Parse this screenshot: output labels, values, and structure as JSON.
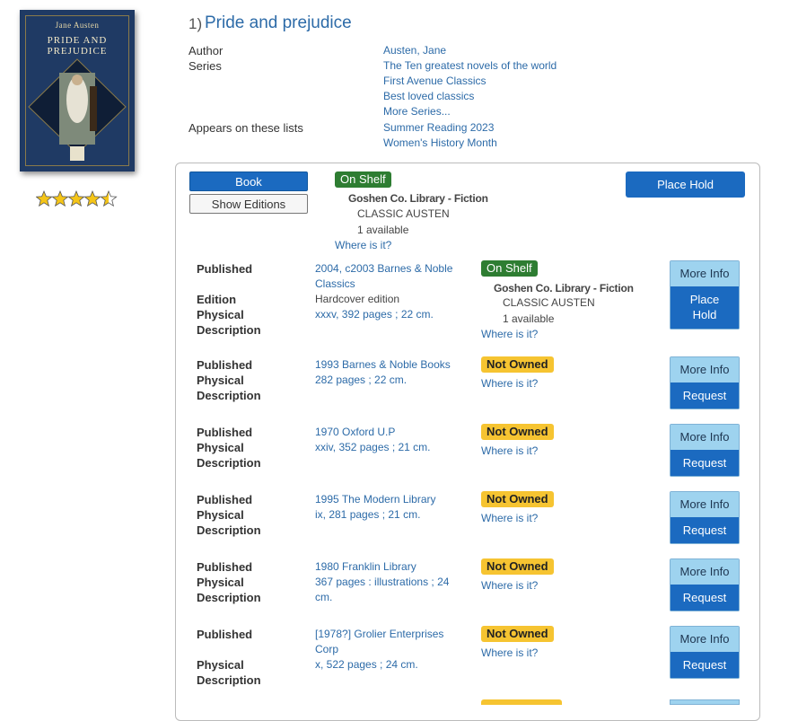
{
  "cover": {
    "author": "Jane Austen",
    "title_line1": "Pride and",
    "title_line2": "Prejudice"
  },
  "rating": {
    "stars": 4.5,
    "max": 5
  },
  "result": {
    "number": "1)",
    "title": "Pride and prejudice"
  },
  "meta": {
    "author_label": "Author",
    "author": "Austen, Jane",
    "series_label": "Series",
    "series": [
      "The Ten greatest novels of the world",
      "First Avenue Classics",
      "Best loved classics",
      "More Series..."
    ],
    "lists_label": "Appears on these lists",
    "lists": [
      "Summer Reading 2023",
      "Women's History Month"
    ]
  },
  "format": {
    "book_button": "Book",
    "editions_button": "Show Editions",
    "status": "On Shelf",
    "location": "Goshen Co. Library - Fiction",
    "call_number": "CLASSIC AUSTEN",
    "available": "1 available",
    "where": "Where is it?",
    "place_hold": "Place Hold"
  },
  "labels": {
    "published": "Published",
    "edition": "Edition",
    "physical": "Physical",
    "description": "Description",
    "more_info": "More Info",
    "request": "Request",
    "place": "Place",
    "hold": "Hold",
    "not_owned": "Not Owned",
    "where": "Where is it?"
  },
  "editions": [
    {
      "published": "2004, c2003 Barnes & Noble Classics",
      "edition": "Hardcover edition",
      "physical": "xxxv, 392 pages ; 22 cm.",
      "status": "On Shelf",
      "location": "Goshen Co. Library - Fiction",
      "call_number": "CLASSIC AUSTEN",
      "available": "1 available"
    },
    {
      "published": "1993 Barnes & Noble Books",
      "physical": "282 pages ; 22 cm.",
      "status": "Not Owned"
    },
    {
      "published": "1970 Oxford U.P",
      "physical": "xxiv, 352 pages ; 21 cm.",
      "status": "Not Owned"
    },
    {
      "published": "1995 The Modern Library",
      "physical": "ix, 281 pages ; 21 cm.",
      "status": "Not Owned"
    },
    {
      "published": "1980 Franklin Library",
      "physical": "367 pages : illustrations ; 24 cm.",
      "status": "Not Owned"
    },
    {
      "published": "[1978?] Grolier Enterprises Corp",
      "physical": "x, 522 pages ; 24 cm.",
      "status": "Not Owned"
    }
  ],
  "colors": {
    "link": "#2d6ba8",
    "primary_button": "#1b6ac0",
    "more_info_button": "#9ed3ef",
    "on_shelf": "#2e7d32",
    "not_owned": "#f6c431"
  }
}
